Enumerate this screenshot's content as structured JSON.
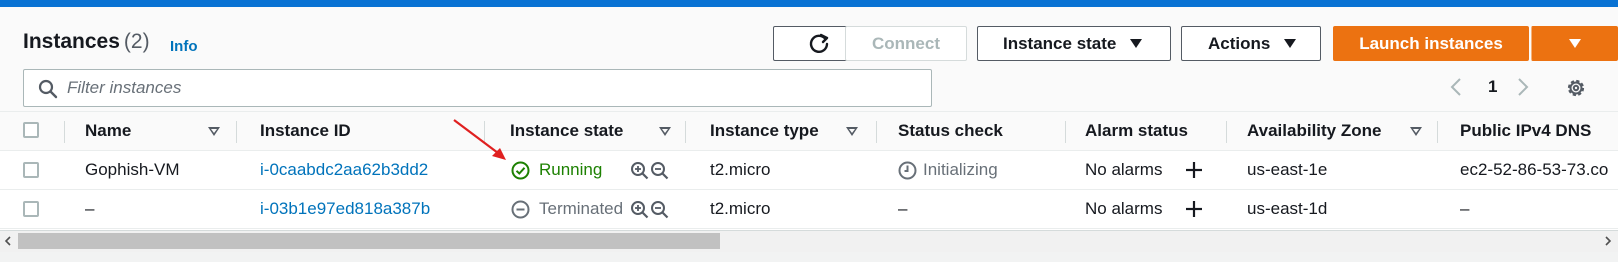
{
  "header": {
    "title": "Instances",
    "count": "(2)",
    "info": "Info"
  },
  "toolbar": {
    "refresh_icon": "refresh-icon",
    "connect": "Connect",
    "instance_state": "Instance state",
    "actions": "Actions",
    "launch": "Launch instances"
  },
  "filter": {
    "placeholder": "Filter instances"
  },
  "pagination": {
    "current_page": "1"
  },
  "table": {
    "columns": [
      "Name",
      "Instance ID",
      "Instance state",
      "Instance type",
      "Status check",
      "Alarm status",
      "Availability Zone",
      "Public IPv4 DNS"
    ],
    "rows": [
      {
        "name": "Gophish-VM",
        "instance_id": "i-0caabdc2aa62b3dd2",
        "state": "Running",
        "type": "t2.micro",
        "status_check": "Initializing",
        "alarm": "No alarms",
        "zone": "us-east-1e",
        "dns": "ec2-52-86-53-73.co"
      },
      {
        "name": "–",
        "instance_id": "i-03b1e97ed818a387b",
        "state": "Terminated",
        "type": "t2.micro",
        "status_check": "–",
        "alarm": "No alarms",
        "zone": "us-east-1d",
        "dns": "–"
      }
    ]
  },
  "colors": {
    "accent_blue": "#0972d3",
    "link_blue": "#0073bb",
    "launch_orange": "#ec7211",
    "running_green": "#1d8102",
    "annotation_red": "#e02020"
  }
}
